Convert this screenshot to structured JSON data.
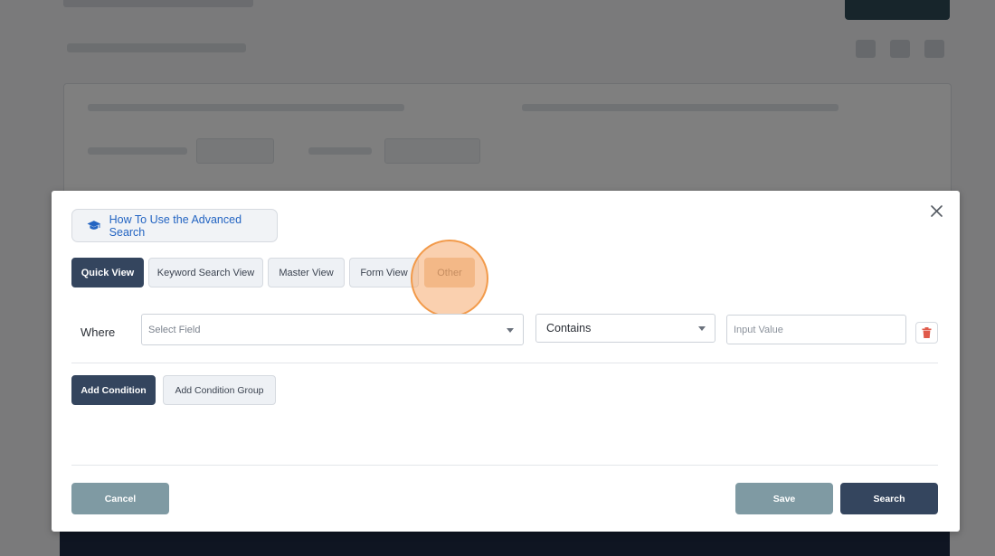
{
  "modal": {
    "help_button_label": "How To Use the Advanced Search",
    "tabs": [
      {
        "label": "Quick View",
        "active": true
      },
      {
        "label": "Keyword Search View",
        "active": false
      },
      {
        "label": "Master View",
        "active": false
      },
      {
        "label": "Form View",
        "active": false
      },
      {
        "label": "Other",
        "active": false,
        "highlighted": true
      }
    ],
    "condition": {
      "where_label": "Where",
      "field_placeholder": "Select Field",
      "operator_value": "Contains",
      "value_placeholder": "Input Value"
    },
    "add_condition_label": "Add Condition",
    "add_condition_group_label": "Add Condition Group",
    "cancel_label": "Cancel",
    "save_label": "Save",
    "search_label": "Search"
  },
  "icons": {
    "help": "graduation-cap-icon",
    "close": "close-icon",
    "delete": "trash-icon",
    "dropdown": "caret-down-icon"
  },
  "colors": {
    "primary_dark": "#34455e",
    "link_blue": "#2364c2",
    "danger": "#e05a4a",
    "save_gray": "#7f9aa3",
    "highlight": "#f29a4a"
  }
}
